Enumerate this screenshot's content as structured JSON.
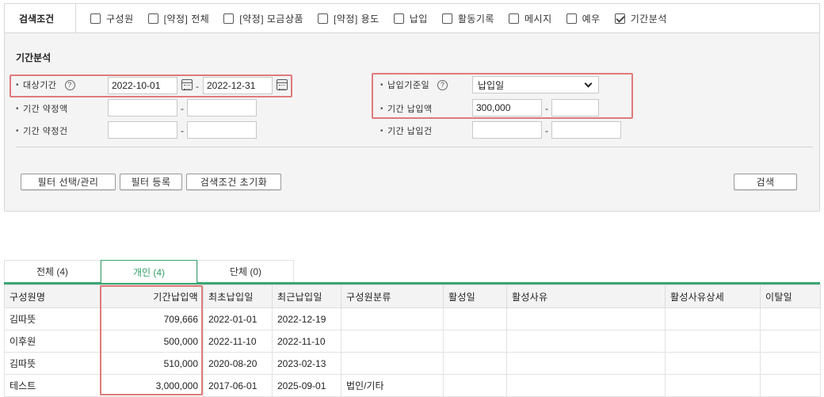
{
  "conditions": {
    "title": "검색조건",
    "items": [
      {
        "label": "구성원",
        "checked": false
      },
      {
        "label": "[약정] 전체",
        "checked": false
      },
      {
        "label": "[약정] 모금상품",
        "checked": false
      },
      {
        "label": "[약정] 용도",
        "checked": false
      },
      {
        "label": "납입",
        "checked": false
      },
      {
        "label": "활동기록",
        "checked": false
      },
      {
        "label": "메시지",
        "checked": false
      },
      {
        "label": "예우",
        "checked": false
      },
      {
        "label": "기간분석",
        "checked": true
      }
    ]
  },
  "panel": {
    "title": "기간분석",
    "period_label": "대상기간",
    "period_from": "2022-10-01",
    "period_to": "2022-12-31",
    "pledge_amount_label": "기간 약정액",
    "pledge_count_label": "기간 약정건",
    "payment_basis_label": "납입기준일",
    "payment_basis_value": "납입일",
    "payment_amount_label": "기간 납입액",
    "payment_amount_from": "300,000",
    "payment_count_label": "기간 납입건",
    "dash": "-",
    "dot": "•",
    "help": "?"
  },
  "buttons": {
    "filter_manage": "필터 선택/관리",
    "filter_register": "필터 등록",
    "reset": "검색조건 초기화",
    "search": "검색"
  },
  "tabs": [
    {
      "label": "전체 (4)",
      "active": false
    },
    {
      "label": "개인 (4)",
      "active": true
    },
    {
      "label": "단체 (0)",
      "active": false
    }
  ],
  "table": {
    "headers": [
      "구성원명",
      "기간납입액",
      "최초납입일",
      "최근납입일",
      "구성원분류",
      "활성일",
      "활성사유",
      "활성사유상세",
      "이탈일"
    ],
    "rows": [
      [
        "김따뜻",
        "709,666",
        "2022-01-01",
        "2022-12-19",
        "",
        "",
        "",
        "",
        ""
      ],
      [
        "이후원",
        "500,000",
        "2022-11-10",
        "2022-11-10",
        "",
        "",
        "",
        "",
        ""
      ],
      [
        "김따뜻",
        "510,000",
        "2020-08-20",
        "2023-02-13",
        "",
        "",
        "",
        "",
        ""
      ],
      [
        "테스트",
        "3,000,000",
        "2017-06-01",
        "2025-09-01",
        "법인/기타",
        "",
        "",
        "",
        ""
      ]
    ]
  },
  "colors": {
    "accent": "#3aa772",
    "highlight": "#e07a7a"
  }
}
